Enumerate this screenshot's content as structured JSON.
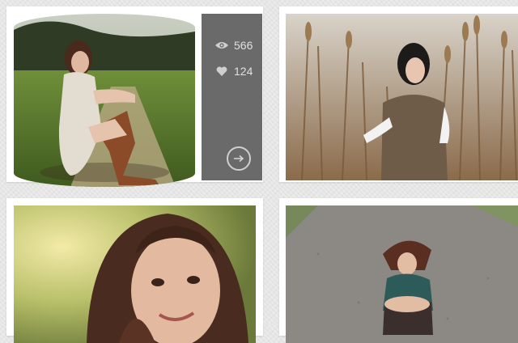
{
  "gallery": {
    "items": [
      {
        "name": "girl-sitting-on-dirt-path",
        "views": "566",
        "likes": "124",
        "stats_visible": true
      },
      {
        "name": "girl-in-tall-reeds"
      },
      {
        "name": "girl-smiling-closeup"
      },
      {
        "name": "girl-sitting-on-road"
      }
    ]
  },
  "icons": {
    "views": "eye-icon",
    "likes": "heart-icon",
    "open": "arrow-right-circle-icon"
  },
  "colors": {
    "card_background": "#ffffff",
    "stats_panel": "#6a6a6a",
    "stats_text": "#e0e0e0"
  }
}
